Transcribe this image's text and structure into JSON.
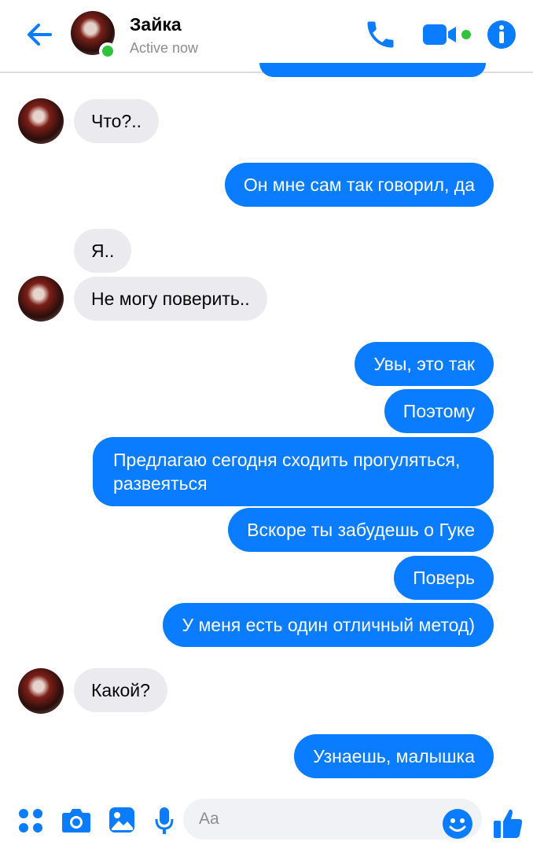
{
  "header": {
    "name": "Зайка",
    "status": "Active now"
  },
  "messages": [
    {
      "side": "in",
      "text": "Что?.."
    },
    {
      "side": "out",
      "text": "Он мне сам так говорил, да"
    },
    {
      "side": "in",
      "text": "Я.."
    },
    {
      "side": "in",
      "text": "Не могу поверить.."
    },
    {
      "side": "out",
      "text": "Увы, это так"
    },
    {
      "side": "out",
      "text": "Поэтому"
    },
    {
      "side": "out",
      "text": "Предлагаю сегодня сходить прогуляться, развеяться"
    },
    {
      "side": "out",
      "text": "Вскоре ты забудешь о Гуке"
    },
    {
      "side": "out",
      "text": "Поверь"
    },
    {
      "side": "out",
      "text": "У меня есть один отличный метод)"
    },
    {
      "side": "in",
      "text": "Какой?"
    },
    {
      "side": "out",
      "text": "Узнаешь, малышка"
    }
  ],
  "composer": {
    "placeholder": "Aa"
  },
  "colors": {
    "accent": "#0a7cff",
    "incoming_bubble": "#ebebef",
    "online": "#31c23d"
  },
  "icons": [
    "back-arrow-icon",
    "phone-icon",
    "video-camera-icon",
    "info-icon",
    "apps-icon",
    "camera-icon",
    "gallery-icon",
    "microphone-icon",
    "emoji-icon",
    "thumbs-up-icon"
  ]
}
